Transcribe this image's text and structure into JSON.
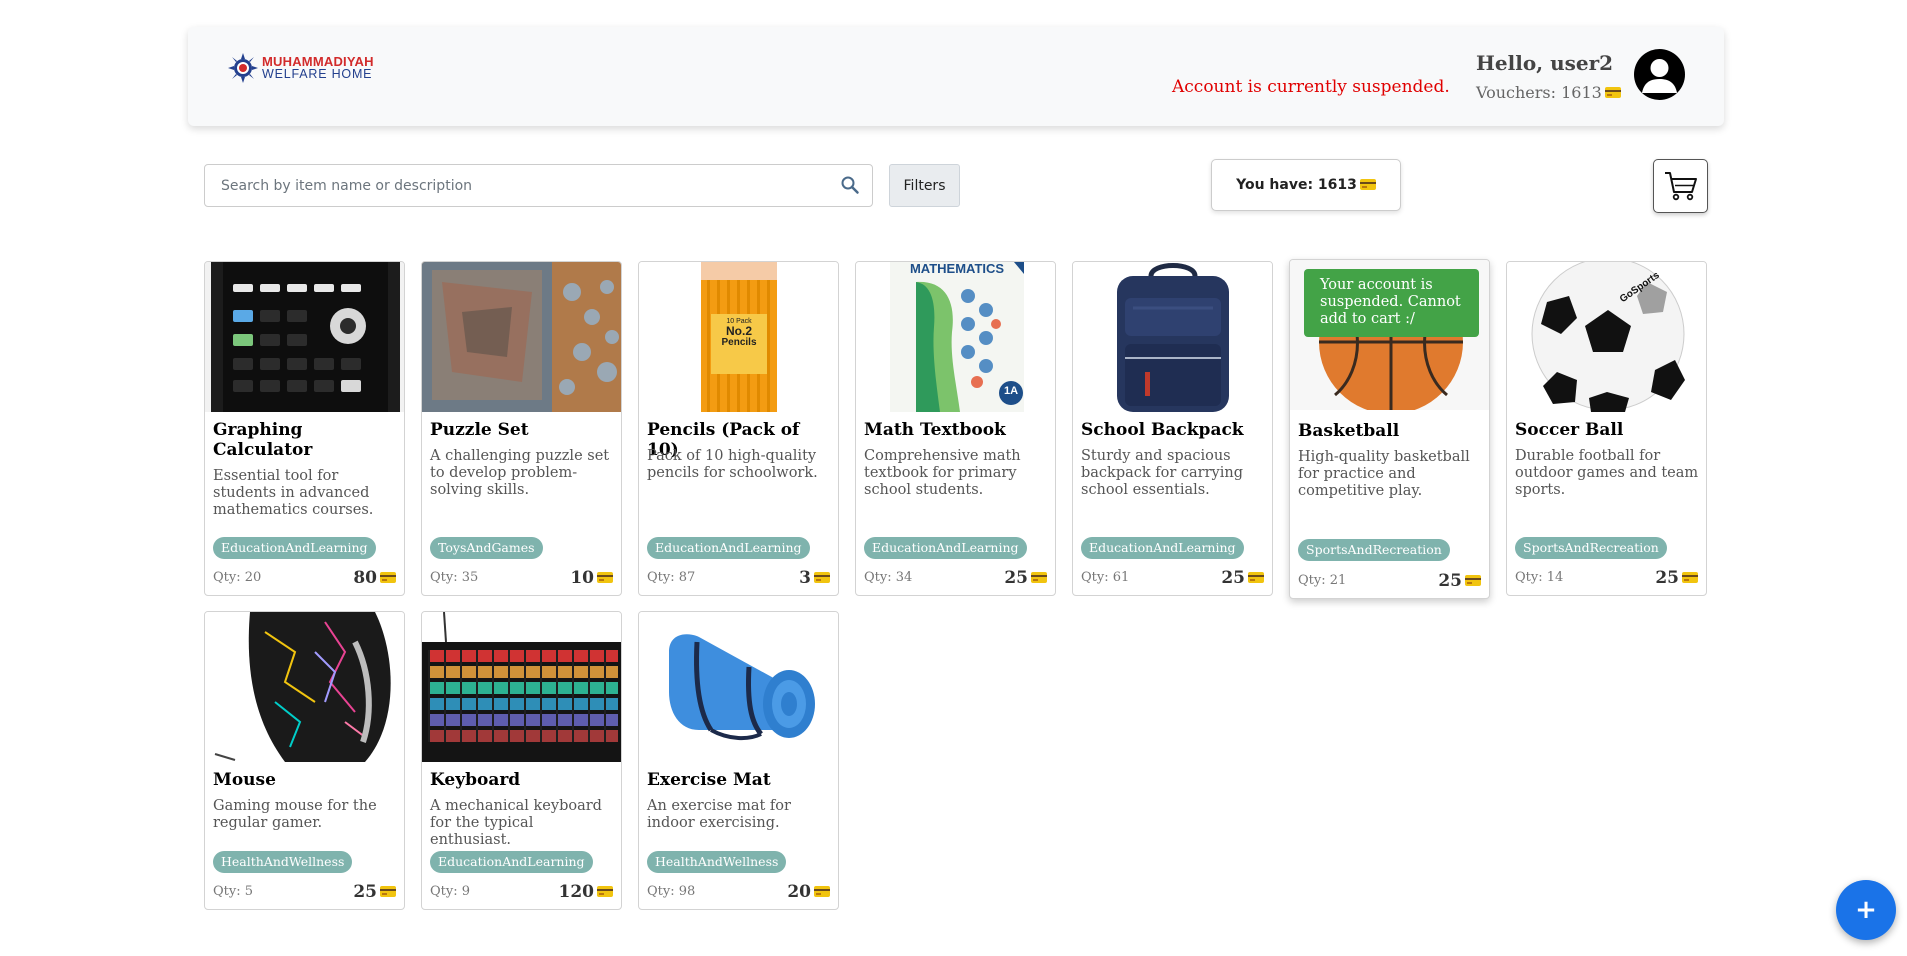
{
  "header": {
    "logo_line1": "MUHAMMADIYAH",
    "logo_line2": "WELFARE HOME",
    "suspended_message": "Account is currently suspended.",
    "greeting": "Hello, user2",
    "vouchers_label": "Vouchers: 1613"
  },
  "toolbar": {
    "search_placeholder": "Search by item name or description",
    "filters_label": "Filters",
    "balance_label": "You have: 1613"
  },
  "toast": {
    "message": "Your account is suspended. Cannot add to cart :/"
  },
  "products": [
    {
      "name": "Graphing Calculator",
      "description": "Essential tool for students in advanced mathematics courses.",
      "category": "EducationAndLearning",
      "qty": "Qty: 20",
      "price": "80",
      "image": "graphing-calculator"
    },
    {
      "name": "Puzzle Set",
      "description": "A challenging puzzle set to develop problem-solving skills.",
      "category": "ToysAndGames",
      "qty": "Qty: 35",
      "price": "10",
      "image": "puzzle-set"
    },
    {
      "name": "Pencils (Pack of 10)",
      "description": "Pack of 10 high-quality pencils for schoolwork.",
      "category": "EducationAndLearning",
      "qty": "Qty: 87",
      "price": "3",
      "image": "pencils",
      "pencil_box_text": [
        "10 Pack",
        "No.2",
        "Pencils"
      ]
    },
    {
      "name": "Math Textbook",
      "description": "Comprehensive math textbook for primary school students.",
      "category": "EducationAndLearning",
      "qty": "Qty: 34",
      "price": "25",
      "image": "math-textbook",
      "cover_title": "MATHEMATICS",
      "cover_badge": "1A"
    },
    {
      "name": "School Backpack",
      "description": "Sturdy and spacious backpack for carrying school essentials.",
      "category": "EducationAndLearning",
      "qty": "Qty: 61",
      "price": "25",
      "image": "school-backpack"
    },
    {
      "name": "Basketball",
      "description": "High-quality basketball for practice and competitive play.",
      "category": "SportsAndRecreation",
      "qty": "Qty: 21",
      "price": "25",
      "image": "basketball"
    },
    {
      "name": "Soccer Ball",
      "description": "Durable football for outdoor games and team sports.",
      "category": "SportsAndRecreation",
      "qty": "Qty: 14",
      "price": "25",
      "image": "soccer-ball",
      "brand_text": "GoSports"
    },
    {
      "name": "Mouse",
      "description": "Gaming mouse for the regular gamer.",
      "category": "HealthAndWellness",
      "qty": "Qty: 5",
      "price": "25",
      "image": "mouse"
    },
    {
      "name": "Keyboard",
      "description": "A mechanical keyboard for the typical enthusiast.",
      "category": "EducationAndLearning",
      "qty": "Qty: 9",
      "price": "120",
      "image": "keyboard"
    },
    {
      "name": "Exercise Mat",
      "description": "An exercise mat for indoor exercising.",
      "category": "HealthAndWellness",
      "qty": "Qty: 98",
      "price": "20",
      "image": "exercise-mat"
    }
  ],
  "fab": {
    "label": "+"
  },
  "colors": {
    "accent": "#1a73e8",
    "tag": "#7fb3ad",
    "toast": "#43a347",
    "suspended": "#e00000"
  }
}
